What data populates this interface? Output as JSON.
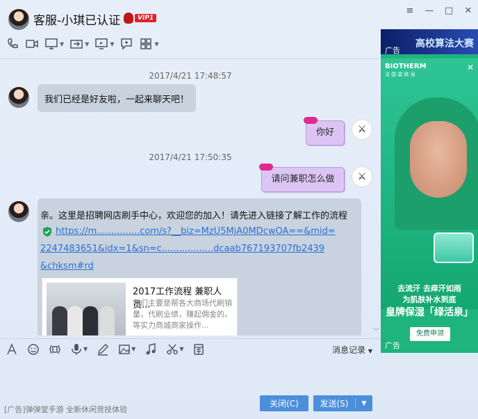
{
  "title": "客服-小琪已认证",
  "vip_badge": "VIP1",
  "window_buttons": {
    "menu": "≡",
    "minimize": "—",
    "maximize": "□",
    "close": "✕"
  },
  "toolbar": [
    "phone-icon",
    "video-icon",
    "screen-share-icon",
    "transfer-file-icon",
    "remote-desktop-icon",
    "whiteboard-icon",
    "apps-icon"
  ],
  "messages": {
    "ts1": "2017/4/21 17:48:57",
    "msg1": "我们已经是好友啦，一起来聊天吧！",
    "msg2": "你好",
    "ts2": "2017/4/21 17:50:35",
    "msg3": "请问兼职怎么做",
    "msg4_text": "亲。这里是招聘网店刷手中心，欢迎您的加入！请先进入链接了解工作的流程",
    "msg4_link_1": "https://m...............com/s?__biz=MzU5MjA0MDcwOA==&mid=",
    "msg4_link_2": "2247483651&idx=1&sn=c..................dcaab767193707fb2439",
    "msg4_link_3": "&chksm#rd",
    "card_title": "2017工作流程 兼职人员...",
    "card_desc": "我们主要是帮各大商场代刷销量，代刷业绩，赚起佣金的。等实力商城商家操作..."
  },
  "me_avatar_glyph": "⚔",
  "input_toolbar": {
    "icons": [
      "font-icon",
      "emoji-icon",
      "gif-icon",
      "voice-icon",
      "pen-icon",
      "image-icon",
      "music-icon",
      "scissors-icon",
      "red-packet-icon"
    ],
    "history": "消息记录"
  },
  "footer_ad": "[广告]弹弹堂手游 全新休闲竞技体验",
  "buttons": {
    "close": "关闭(C)",
    "send": "发送(S)"
  },
  "ad": {
    "top_title": "高校算法大赛",
    "label": "广告",
    "brand": "BIOTHERM",
    "brand_sub": "法 国 碧 欧 泉",
    "close": "✕",
    "line1": "去流汗 去痒汗如雨\n为肌肤补水到底",
    "line2": "皇牌保湿「绿活泉」",
    "cta": "免费申领",
    "label2": "广告"
  }
}
